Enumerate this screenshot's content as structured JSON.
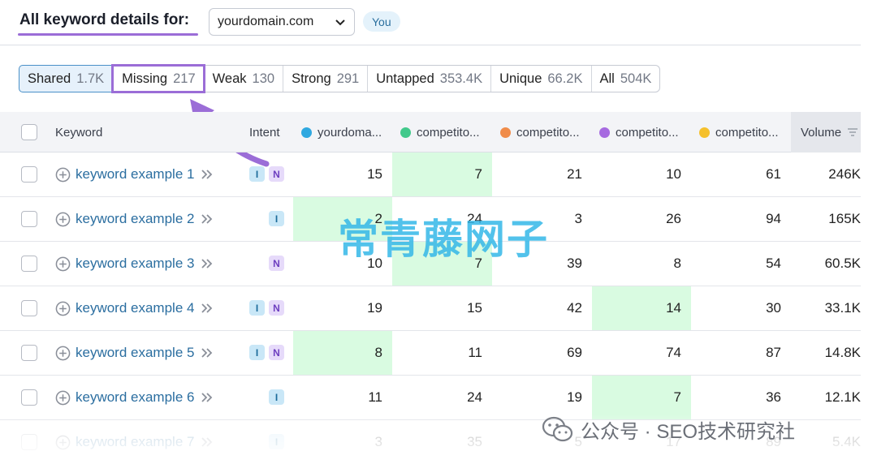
{
  "header": {
    "title": "All keyword details for:",
    "domain": "yourdomain.com",
    "you_badge": "You"
  },
  "tabs": [
    {
      "label": "Shared",
      "count": "1.7K"
    },
    {
      "label": "Missing",
      "count": "217"
    },
    {
      "label": "Weak",
      "count": "130"
    },
    {
      "label": "Strong",
      "count": "291"
    },
    {
      "label": "Untapped",
      "count": "353.4K"
    },
    {
      "label": "Unique",
      "count": "66.2K"
    },
    {
      "label": "All",
      "count": "504K"
    }
  ],
  "columns": {
    "keyword": "Keyword",
    "intent": "Intent",
    "domains": [
      {
        "label": "yourdoma...",
        "color": "#2fa8e0"
      },
      {
        "label": "competito...",
        "color": "#41c98b"
      },
      {
        "label": "competito...",
        "color": "#f08c4a"
      },
      {
        "label": "competito...",
        "color": "#a66ae0"
      },
      {
        "label": "competito...",
        "color": "#f5c02c"
      }
    ],
    "volume": "Volume"
  },
  "rows": [
    {
      "keyword": "keyword example 1",
      "intent": [
        "I",
        "N"
      ],
      "values": [
        "15",
        "7",
        "21",
        "10",
        "61"
      ],
      "volume": "246K"
    },
    {
      "keyword": "keyword example 2",
      "intent": [
        "I"
      ],
      "values": [
        "2",
        "24",
        "3",
        "26",
        "94"
      ],
      "volume": "165K"
    },
    {
      "keyword": "keyword example 3",
      "intent": [
        "N"
      ],
      "values": [
        "10",
        "7",
        "39",
        "8",
        "54"
      ],
      "volume": "60.5K"
    },
    {
      "keyword": "keyword example 4",
      "intent": [
        "I",
        "N"
      ],
      "values": [
        "19",
        "15",
        "42",
        "14",
        "30"
      ],
      "volume": "33.1K"
    },
    {
      "keyword": "keyword example 5",
      "intent": [
        "I",
        "N"
      ],
      "values": [
        "8",
        "11",
        "69",
        "74",
        "87"
      ],
      "volume": "14.8K"
    },
    {
      "keyword": "keyword example 6",
      "intent": [
        "I"
      ],
      "values": [
        "11",
        "24",
        "19",
        "7",
        "36"
      ],
      "volume": "12.1K"
    },
    {
      "keyword": "keyword example 7",
      "intent": [
        "I"
      ],
      "values": [
        "3",
        "35",
        "5",
        "17",
        "89"
      ],
      "volume": "5.4K"
    }
  ],
  "watermark": "常青藤网子",
  "wechat_caption": "公众号 · SEO技术研究社",
  "colors": {
    "highlight": "#d9fbe1",
    "accent_purple": "#9b6dd7",
    "link_blue": "#2b6ea0"
  }
}
